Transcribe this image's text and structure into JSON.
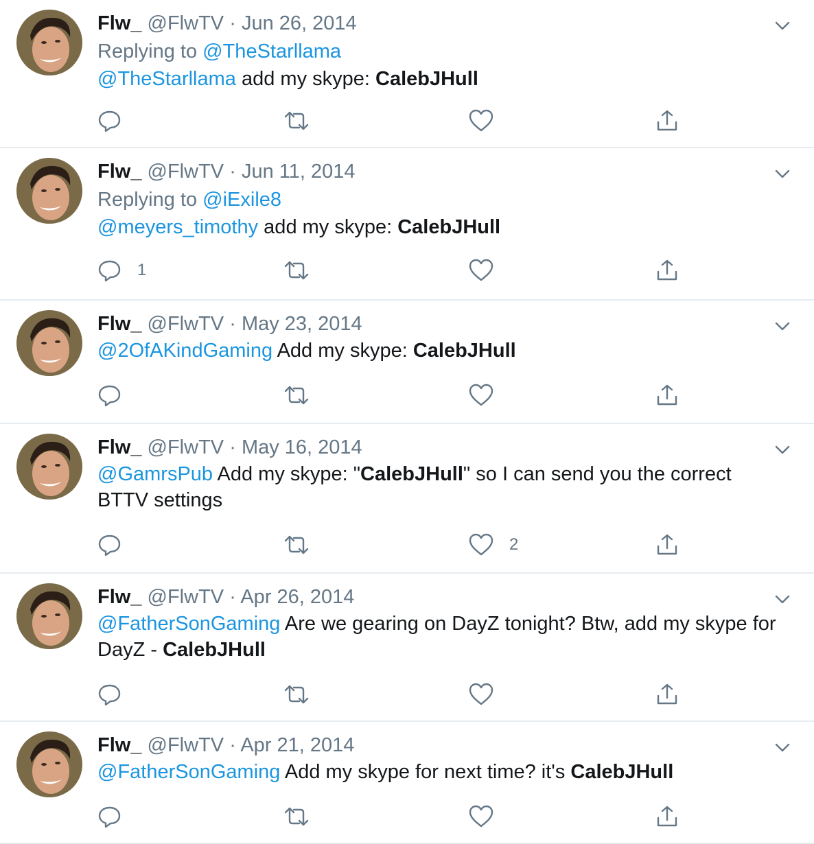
{
  "tweets": [
    {
      "name": "Flw_",
      "handle": "@FlwTV",
      "sep": "·",
      "date": "Jun 26, 2014",
      "replying_prefix": "Replying to ",
      "replying_to": "@TheStarllama",
      "mention": "@TheStarllama",
      "text_before": " add my skype: ",
      "bold": "CalebJHull",
      "text_after": "",
      "reply_count": "",
      "like_count": ""
    },
    {
      "name": "Flw_",
      "handle": "@FlwTV",
      "sep": "·",
      "date": "Jun 11, 2014",
      "replying_prefix": "Replying to ",
      "replying_to": "@iExile8",
      "mention": "@meyers_timothy",
      "text_before": " add my skype: ",
      "bold": "CalebJHull",
      "text_after": "",
      "reply_count": "1",
      "like_count": ""
    },
    {
      "name": "Flw_",
      "handle": "@FlwTV",
      "sep": "·",
      "date": "May 23, 2014",
      "mention": "@2OfAKindGaming",
      "text_before": " Add my skype: ",
      "bold": "CalebJHull",
      "text_after": "",
      "reply_count": "",
      "like_count": ""
    },
    {
      "name": "Flw_",
      "handle": "@FlwTV",
      "sep": "·",
      "date": "May 16, 2014",
      "mention": "@GamrsPub",
      "text_before": " Add my skype: \"",
      "bold": "CalebJHull",
      "text_after": "\" so I can send you the correct BTTV settings",
      "reply_count": "",
      "like_count": "2"
    },
    {
      "name": "Flw_",
      "handle": "@FlwTV",
      "sep": "·",
      "date": "Apr 26, 2014",
      "mention": "@FatherSonGaming",
      "text_before": " Are we gearing on DayZ tonight?  Btw, add my skype for DayZ - ",
      "bold": "CalebJHull",
      "text_after": "",
      "reply_count": "",
      "like_count": ""
    },
    {
      "name": "Flw_",
      "handle": "@FlwTV",
      "sep": "·",
      "date": "Apr 21, 2014",
      "mention": "@FatherSonGaming",
      "text_before": " Add my skype for next time?  it's ",
      "bold": "CalebJHull",
      "text_after": "",
      "reply_count": "",
      "like_count": ""
    }
  ],
  "icons": {
    "avatar": "avatar-photo",
    "caret": "chevron-down-icon",
    "reply": "reply-icon",
    "retweet": "retweet-icon",
    "like": "heart-icon",
    "share": "share-icon"
  },
  "colors": {
    "link": "#1b95e0",
    "muted": "#657786",
    "text": "#14171a",
    "divider": "#e6ecf0"
  }
}
